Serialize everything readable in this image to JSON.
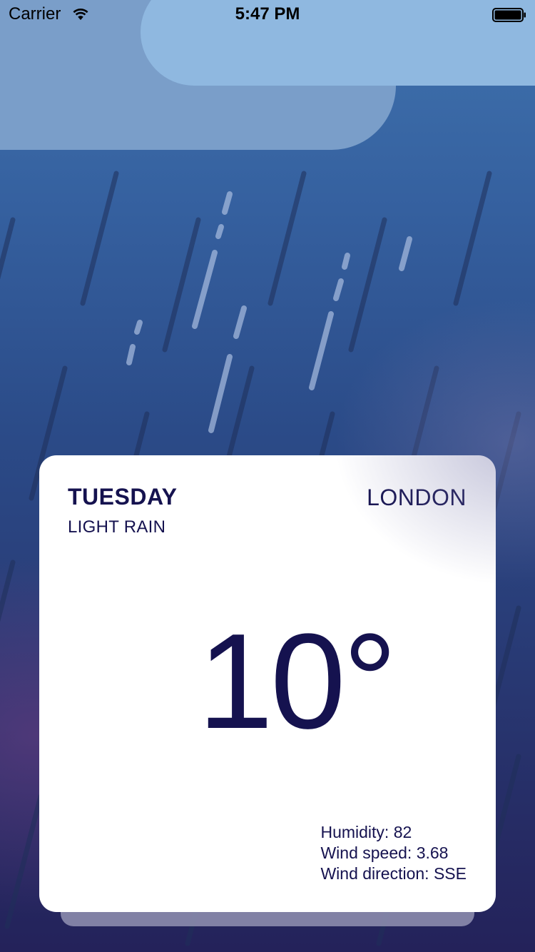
{
  "status_bar": {
    "carrier": "Carrier",
    "time": "5:47 PM",
    "wifi_icon": "wifi-icon",
    "battery_icon": "battery-icon"
  },
  "weather": {
    "day": "TUESDAY",
    "condition": "LIGHT RAIN",
    "city": "LONDON",
    "temperature": "10°",
    "humidity_label": "Humidity:",
    "humidity_value": "82",
    "wind_speed_label": "Wind speed:",
    "wind_speed_value": "3.68",
    "wind_direction_label": "Wind direction:",
    "wind_direction_value": "SSE"
  },
  "colors": {
    "card_text": "#15124f",
    "sky_top": "#3f72ad",
    "sky_bottom": "#24225a",
    "cloud_front": "#8fb8e0",
    "cloud_back": "#7a9ec9"
  }
}
